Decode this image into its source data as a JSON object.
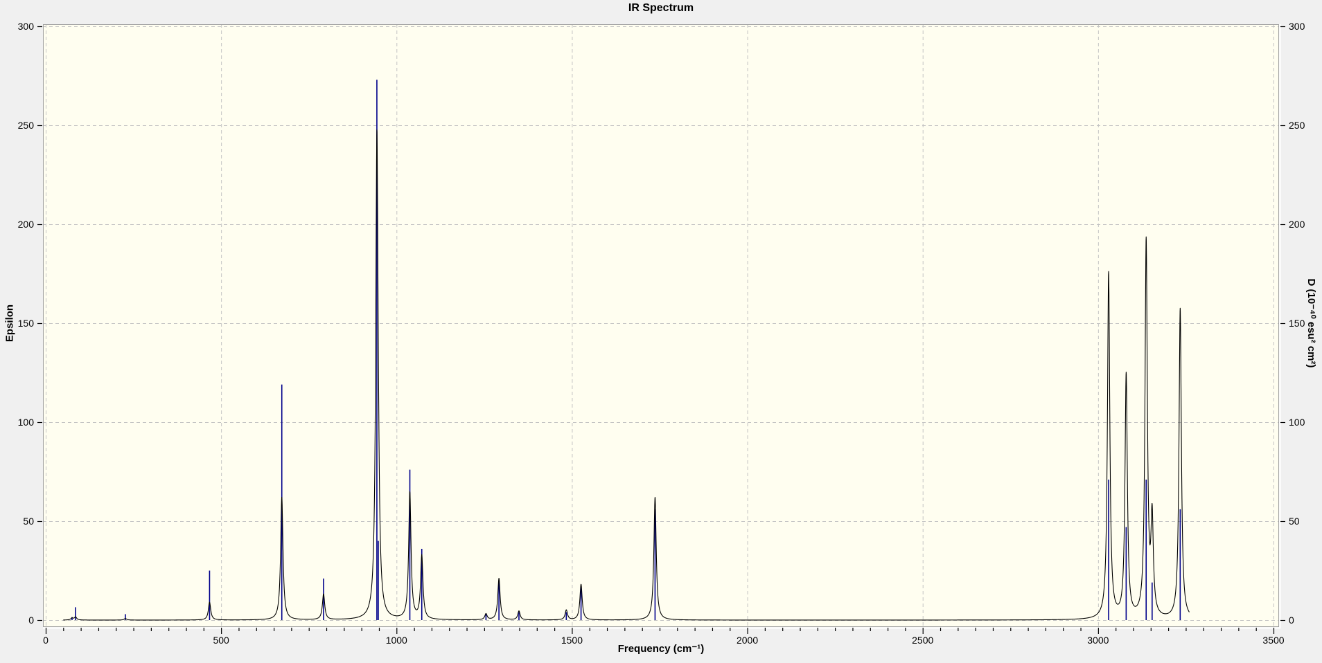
{
  "window": {
    "background_color": "#f0f0f0",
    "plot_background_color": "#fffef0",
    "grid_color": "#c3c3c3",
    "frame_color": "#a0a0a0"
  },
  "chart_data": {
    "type": "line",
    "title": "IR Spectrum",
    "xlabel": "Frequency (cm⁻¹)",
    "ylabel_left": "Epsilon",
    "ylabel_right": "D (10⁻⁴⁰ esu² cm²)",
    "xlim": [
      0,
      3500
    ],
    "ylim": [
      0,
      300
    ],
    "x_tick_values": [
      0,
      500,
      1000,
      1500,
      2000,
      2500,
      3000,
      3500
    ],
    "x_tick_labels": [
      "0",
      "500",
      "1000",
      "1500",
      "2000",
      "2500",
      "3000",
      "3500"
    ],
    "x_minor_tick_step": 50,
    "y_tick_values": [
      0,
      50,
      100,
      150,
      200,
      250,
      300
    ],
    "y_tick_labels": [
      "0",
      "50",
      "100",
      "150",
      "200",
      "250",
      "300"
    ],
    "grid": "dashed-major",
    "legend": "none",
    "curve_color": "#000000",
    "stick_color": "#00008b",
    "curve_hwhm_cm1": 4,
    "curve_x_range": [
      50,
      3260
    ],
    "series": [
      {
        "name": "epsilon-broadened-curve",
        "style": "lorentzian-sum",
        "peaks_x_frequency": [
          75,
          85,
          227,
          467,
          673,
          792,
          944,
          948,
          1038,
          1072,
          1255,
          1292,
          1349,
          1484,
          1526,
          1737,
          3030,
          3080,
          3137,
          3154,
          3234
        ],
        "peaks_epsilon": [
          1,
          1.5,
          0.8,
          9,
          62,
          13,
          235,
          25,
          64,
          32,
          3,
          21,
          4.5,
          5,
          18,
          62,
          175,
          123,
          190,
          48,
          157
        ]
      },
      {
        "name": "dipole-strength-sticks",
        "style": "vertical-sticks",
        "peaks_x_frequency": [
          75,
          85,
          227,
          467,
          673,
          792,
          944,
          948,
          1038,
          1072,
          1255,
          1292,
          1349,
          1484,
          1526,
          1737,
          3030,
          3080,
          3137,
          3154,
          3234
        ],
        "peaks_d": [
          1.5,
          6.5,
          3,
          25,
          119,
          21,
          273,
          40,
          76,
          36,
          3,
          20,
          4,
          4,
          17,
          56,
          71,
          47,
          71,
          19,
          56
        ]
      }
    ]
  }
}
